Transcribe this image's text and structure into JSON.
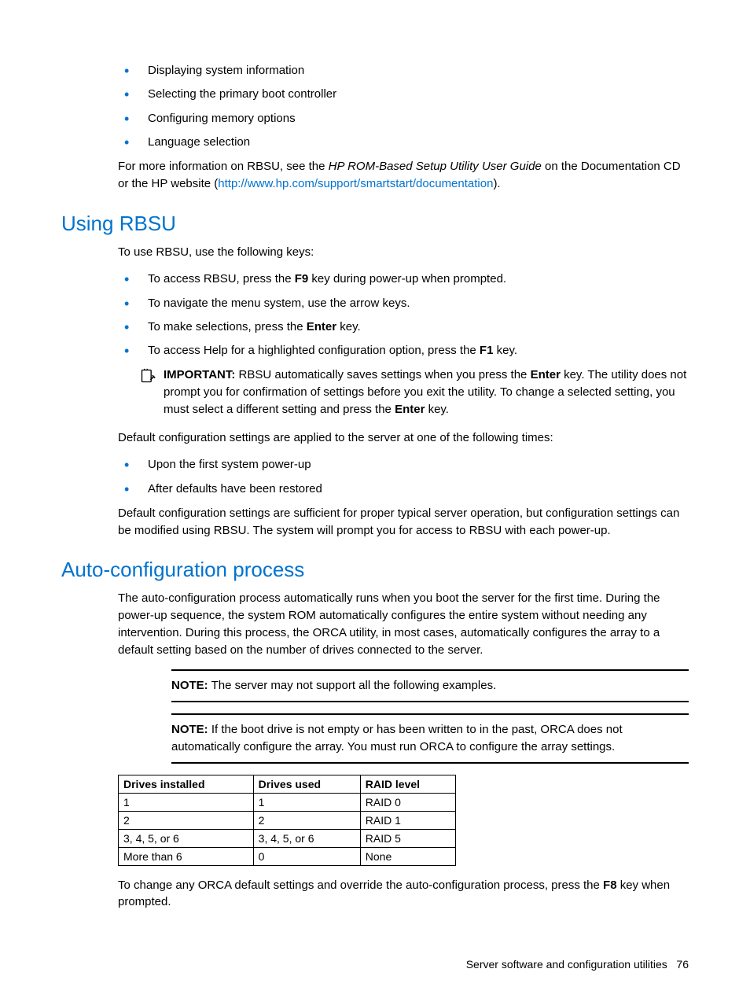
{
  "intro_bullets": [
    "Displaying system information",
    "Selecting the primary boot controller",
    "Configuring memory options",
    "Language selection"
  ],
  "intro_after": {
    "prefix": "For more information on RBSU, see the ",
    "italic": "HP ROM-Based Setup Utility User Guide",
    "mid": " on the Documentation CD or the HP website (",
    "link": "http://www.hp.com/support/smartstart/documentation",
    "suffix": ")."
  },
  "rbsu": {
    "heading": "Using RBSU",
    "lead": "To use RBSU, use the following keys:",
    "items": [
      {
        "pre": "To access RBSU, press the ",
        "bold": "F9",
        "post": " key during power-up when prompted."
      },
      {
        "pre": "To navigate the menu system, use the arrow keys.",
        "bold": "",
        "post": ""
      },
      {
        "pre": "To make selections, press the ",
        "bold": "Enter",
        "post": " key."
      },
      {
        "pre": "To access Help for a highlighted configuration option, press the ",
        "bold": "F1",
        "post": " key."
      }
    ],
    "important": {
      "label": "IMPORTANT:",
      "pre": "  RBSU automatically saves settings when you press the ",
      "bold1": "Enter",
      "mid": " key. The utility does not prompt you for confirmation of settings before you exit the utility. To change a selected setting, you must select a different setting and press the ",
      "bold2": "Enter",
      "post": " key."
    },
    "after1": "Default configuration settings are applied to the server at one of the following times:",
    "after_bullets": [
      "Upon the first system power-up",
      "After defaults have been restored"
    ],
    "after2": "Default configuration settings are sufficient for proper typical server operation, but configuration settings can be modified using RBSU. The system will prompt you for access to RBSU with each power-up."
  },
  "auto": {
    "heading": "Auto-configuration process",
    "lead": "The auto-configuration process automatically runs when you boot the server for the first time. During the power-up sequence, the system ROM automatically configures the entire system without needing any intervention. During this process, the ORCA utility, in most cases, automatically configures the array to a default setting based on the number of drives connected to the server.",
    "note1": {
      "label": "NOTE:",
      "text": "  The server may not support all the following examples."
    },
    "note2": {
      "label": "NOTE:",
      "text": "  If the boot drive is not empty or has been written to in the past, ORCA does not automatically configure the array. You must run ORCA to configure the array settings."
    },
    "table": {
      "headers": [
        "Drives installed",
        "Drives used",
        "RAID level"
      ],
      "rows": [
        [
          "1",
          "1",
          "RAID 0"
        ],
        [
          "2",
          "2",
          "RAID 1"
        ],
        [
          "3, 4, 5, or 6",
          "3, 4, 5, or 6",
          "RAID 5"
        ],
        [
          "More than 6",
          "0",
          "None"
        ]
      ]
    },
    "closing": {
      "pre": "To change any ORCA default settings and override the auto-configuration process, press the ",
      "bold": "F8",
      "post": " key when prompted."
    }
  },
  "footer": {
    "section": "Server software and configuration utilities",
    "page": "76"
  }
}
